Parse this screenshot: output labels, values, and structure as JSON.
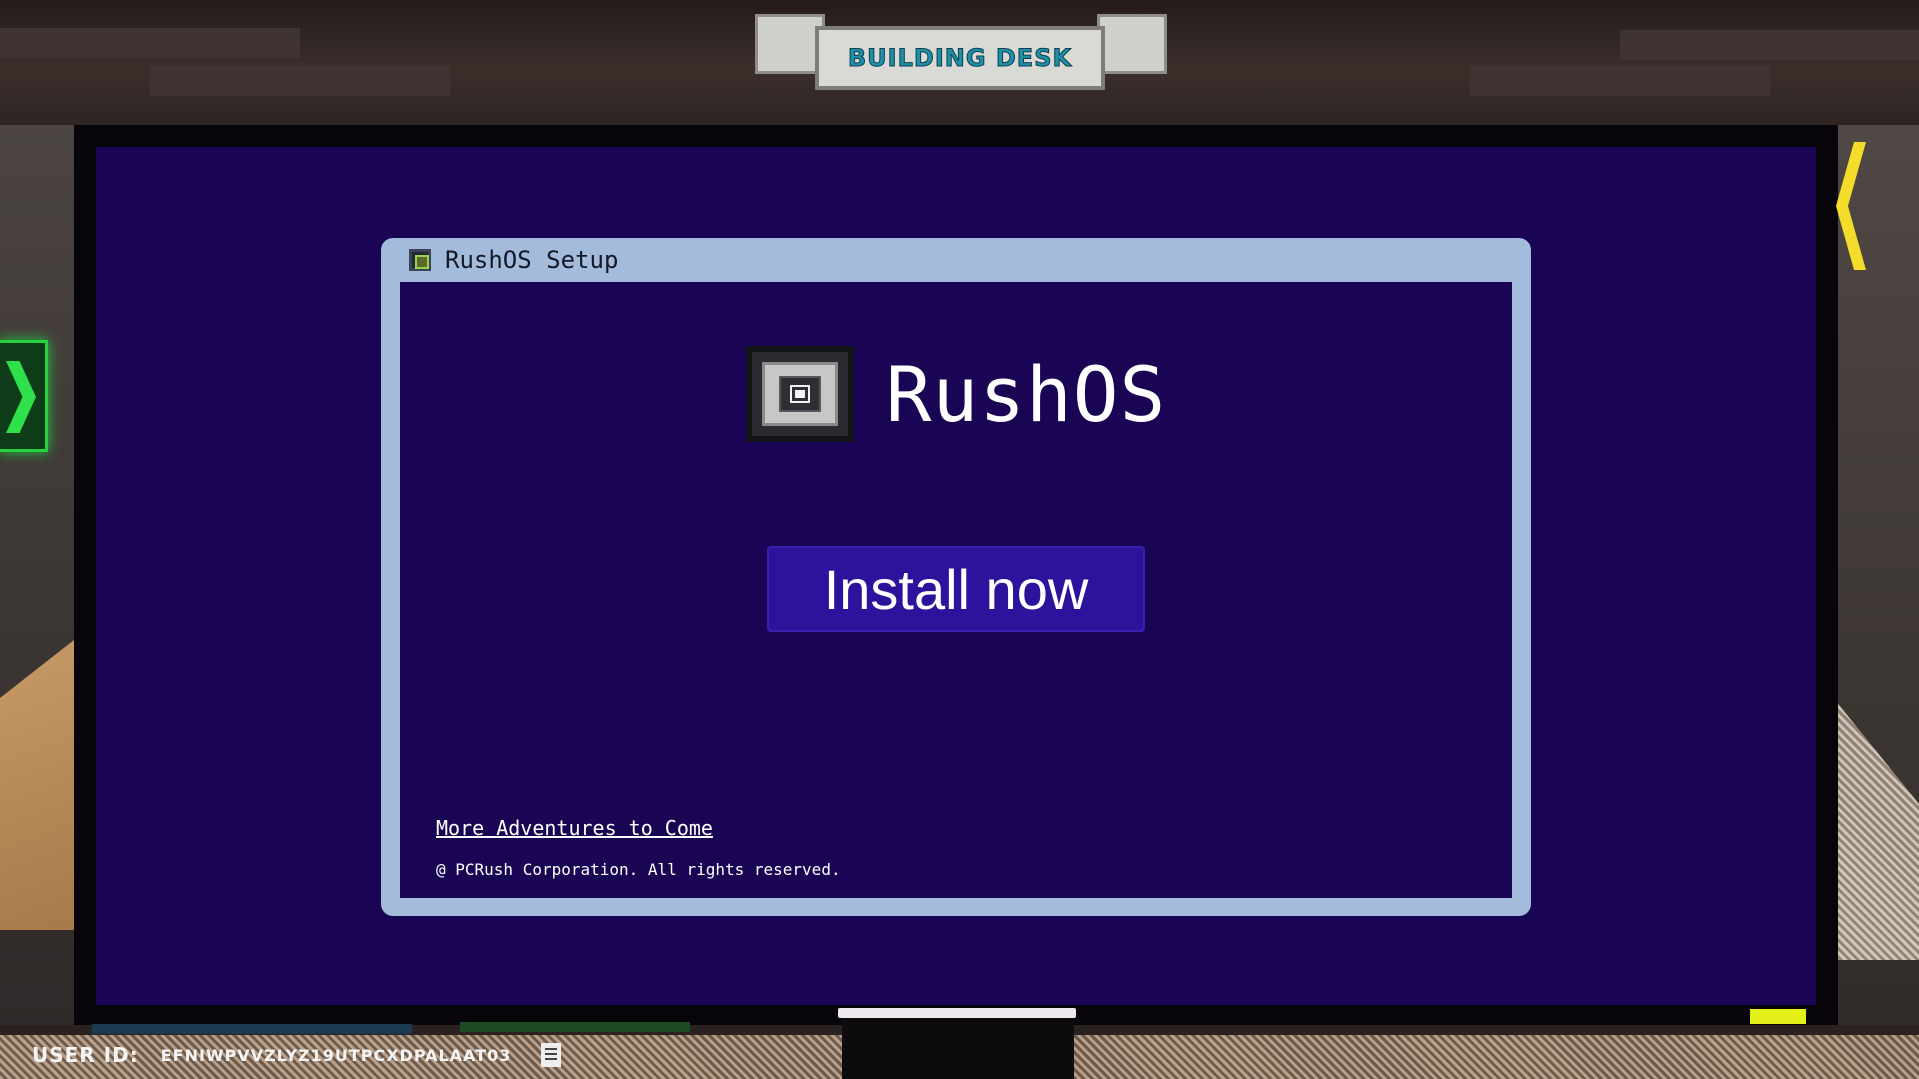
{
  "location_sign": "BUILDING DESK",
  "setup_window": {
    "title": "RushOS Setup",
    "os_name": "RushOS",
    "install_button": "Install now",
    "more_link": "More Adventures to Come",
    "copyright": "@ PCRush Corporation. All rights reserved."
  },
  "user": {
    "id_label": "USER ID:",
    "id_value": "EFNIWPVVZLYZ19UTPCXDPALAAT03"
  },
  "icons": {
    "nav_left": "chevron-right-icon",
    "nav_right": "chevron-left-icon",
    "window": "rushos-logo-icon",
    "copy": "copy-icon"
  },
  "colors": {
    "screen_bg": "#1a0454",
    "window_frame": "#a4bcdb",
    "button_bg": "#2d129b",
    "nav_green": "#2ee04a",
    "nav_yellow": "#f3dc2a",
    "sign_text": "#1f8fa8"
  }
}
